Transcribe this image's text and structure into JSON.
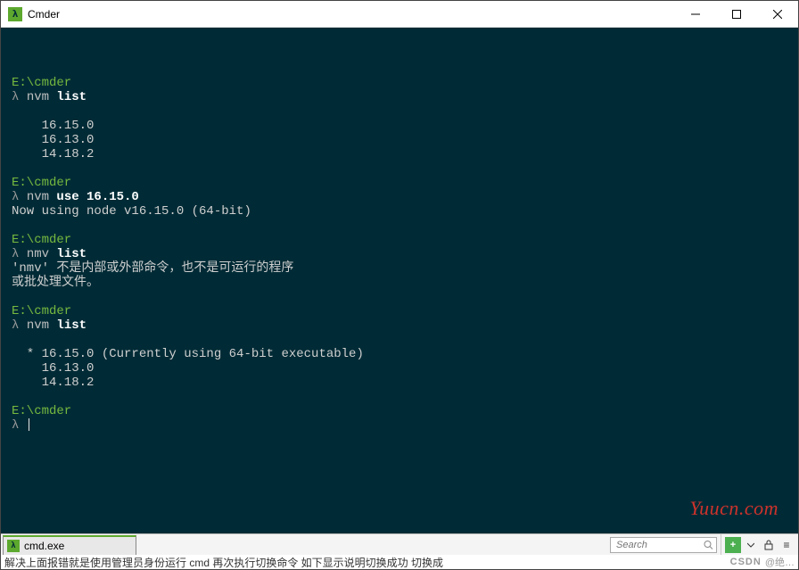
{
  "titlebar": {
    "icon_glyph": "λ",
    "title": "Cmder"
  },
  "terminal": {
    "blocks": [
      {
        "path": "E:\\cmder",
        "prompt": "λ",
        "cmd_base": "nvm ",
        "cmd_bold": "list",
        "output": [
          "",
          "    16.15.0",
          "    16.13.0",
          "    14.18.2",
          ""
        ]
      },
      {
        "path": "E:\\cmder",
        "prompt": "λ",
        "cmd_base": "nvm ",
        "cmd_bold": "use 16.15.0",
        "output": [
          "Now using node v16.15.0 (64-bit)",
          ""
        ]
      },
      {
        "path": "E:\\cmder",
        "prompt": "λ",
        "cmd_base": "nmv ",
        "cmd_bold": "list",
        "output": [
          "'nmv' 不是内部或外部命令，也不是可运行的程序",
          "或批处理文件。",
          ""
        ]
      },
      {
        "path": "E:\\cmder",
        "prompt": "λ",
        "cmd_base": "nvm ",
        "cmd_bold": "list",
        "output": [
          "",
          "  * 16.15.0 (Currently using 64-bit executable)",
          "    16.13.0",
          "    14.18.2",
          ""
        ]
      },
      {
        "path": "E:\\cmder",
        "prompt": "λ",
        "cmd_base": "",
        "cmd_bold": "",
        "cursor": true,
        "output": []
      }
    ]
  },
  "watermark": "Yuucn.com",
  "statusbar": {
    "tab_icon_glyph": "λ",
    "tab_label": "cmd.exe",
    "search_placeholder": "Search",
    "plus": "+",
    "menu": "≡"
  },
  "footer": {
    "left_text": "解决上面报错就是使用管理员身份运行 cmd  再次执行切换命令  如下显示说明切换成功  切换成",
    "right_logo": "CSDN",
    "right_user": "@绝…"
  }
}
